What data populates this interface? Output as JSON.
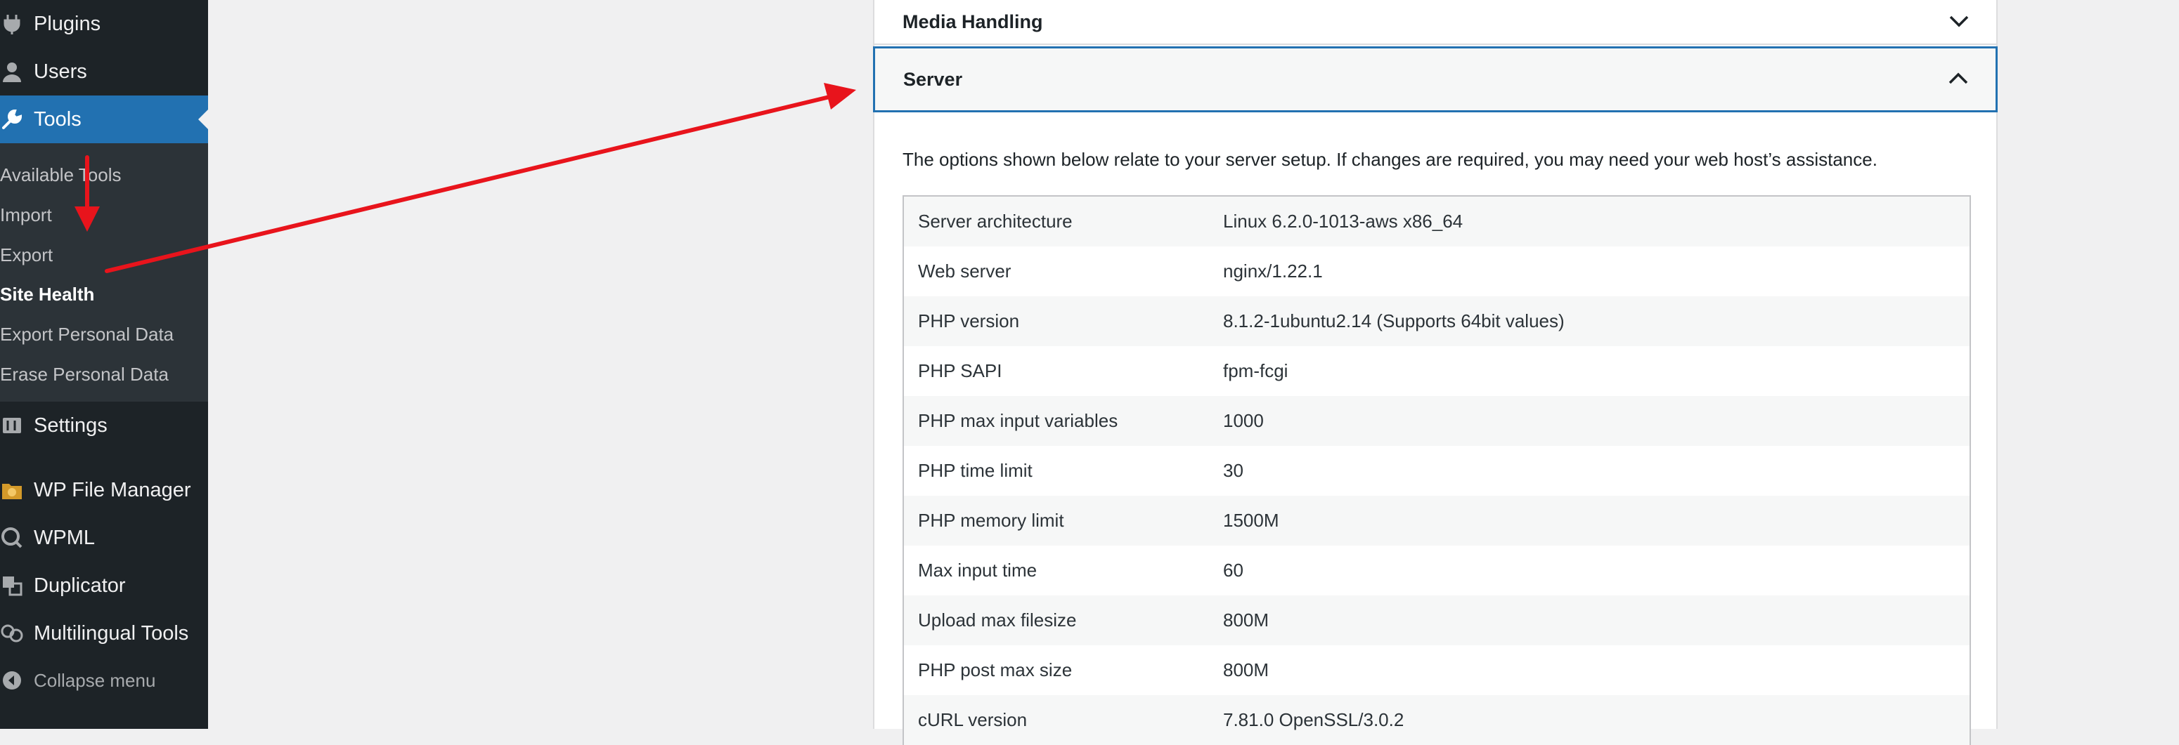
{
  "sidebar": {
    "items": [
      {
        "label": "Plugins",
        "icon": "plugin-icon"
      },
      {
        "label": "Users",
        "icon": "user-icon"
      },
      {
        "label": "Tools",
        "icon": "wrench-icon"
      },
      {
        "label": "Settings",
        "icon": "settings-icon"
      },
      {
        "label": "WP File Manager",
        "icon": "file-manager-icon"
      },
      {
        "label": "WPML",
        "icon": "wpml-icon"
      },
      {
        "label": "Duplicator",
        "icon": "duplicator-icon"
      },
      {
        "label": "Multilingual Tools",
        "icon": "multilingual-icon"
      }
    ],
    "submenu": [
      "Available Tools",
      "Import",
      "Export",
      "Site Health",
      "Export Personal Data",
      "Erase Personal Data"
    ],
    "collapse_label": "Collapse menu",
    "colors": {
      "background": "#1d2327",
      "submenu": "#2c3338",
      "current": "#2271b1"
    }
  },
  "panel": {
    "media_title": "Media Handling",
    "server_title": "Server",
    "description": "The options shown below relate to your server setup. If changes are required, you may need your web host’s assistance.",
    "rows": [
      {
        "key": "Server architecture",
        "value": "Linux 6.2.0-1013-aws x86_64"
      },
      {
        "key": "Web server",
        "value": "nginx/1.22.1"
      },
      {
        "key": "PHP version",
        "value": "8.1.2-1ubuntu2.14 (Supports 64bit values)"
      },
      {
        "key": "PHP SAPI",
        "value": "fpm-fcgi"
      },
      {
        "key": "PHP max input variables",
        "value": "1000"
      },
      {
        "key": "PHP time limit",
        "value": "30"
      },
      {
        "key": "PHP memory limit",
        "value": "1500M"
      },
      {
        "key": "Max input time",
        "value": "60"
      },
      {
        "key": "Upload max filesize",
        "value": "800M"
      },
      {
        "key": "PHP post max size",
        "value": "800M"
      },
      {
        "key": "cURL version",
        "value": "7.81.0 OpenSSL/3.0.2"
      }
    ]
  },
  "annotation_color": "#e8141c"
}
